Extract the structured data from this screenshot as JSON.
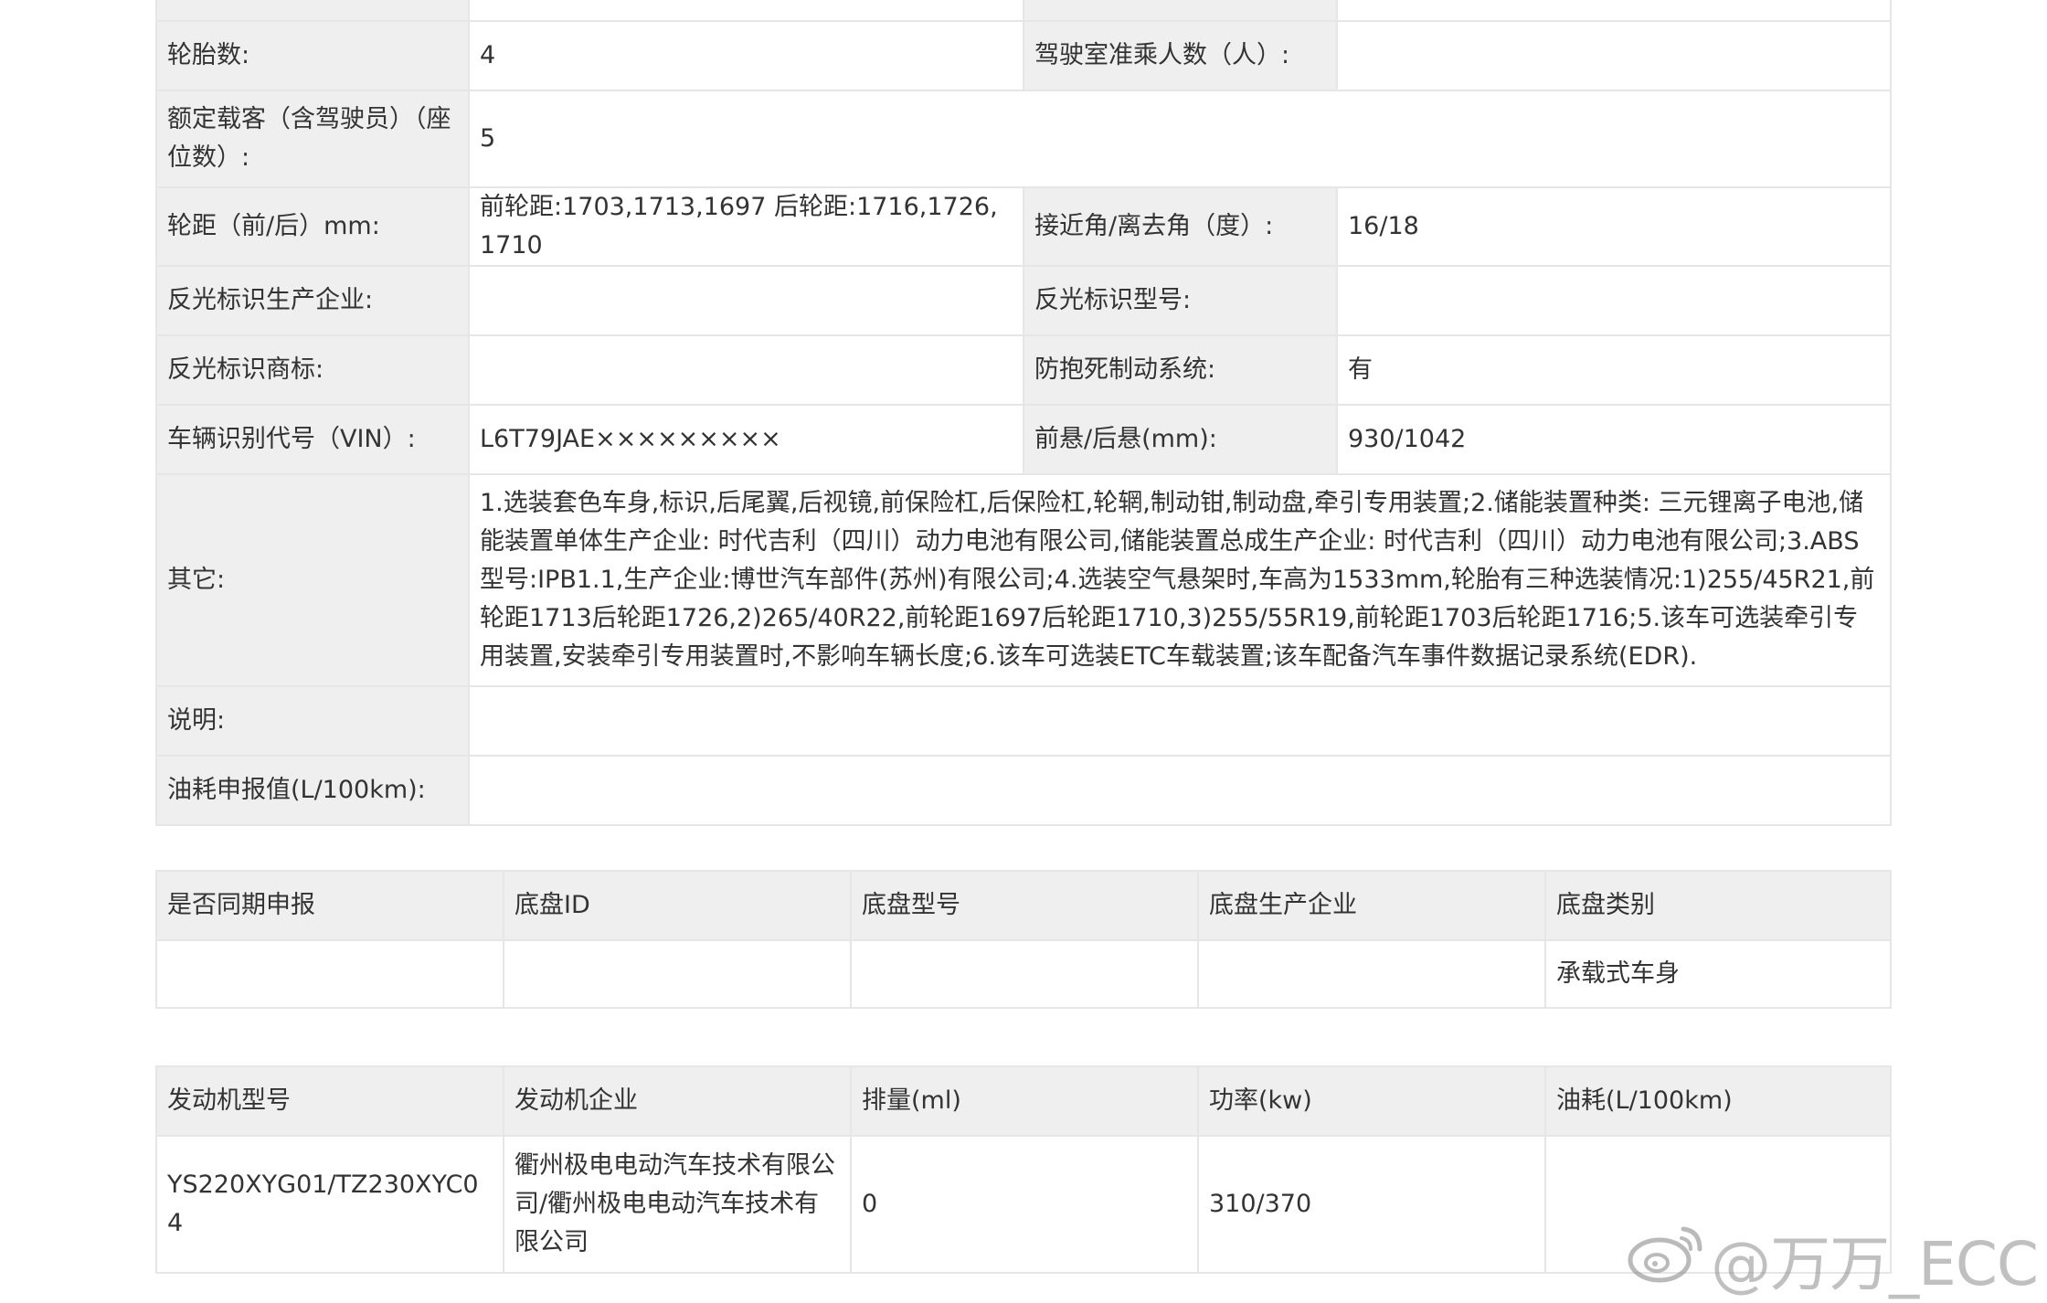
{
  "spec": {
    "top_partial": {
      "label": "",
      "value": "",
      "label2": "",
      "value2": ""
    },
    "tires": {
      "label": "轮胎数:",
      "value": "4",
      "label2": "驾驶室准乘人数（人）:",
      "value2": ""
    },
    "seats": {
      "label": "额定载客（含驾驶员）（座位数）:",
      "value": "5"
    },
    "track": {
      "label": "轮距（前/后）mm:",
      "value": "前轮距:1703,1713,1697 后轮距:1716,1726,1710",
      "label2": "接近角/离去角（度）:",
      "value2": "16/18"
    },
    "reflective_maker": {
      "label": "反光标识生产企业:",
      "value": "",
      "label2": "反光标识型号:",
      "value2": ""
    },
    "reflective_brand": {
      "label": "反光标识商标:",
      "value": "",
      "label2": "防抱死制动系统:",
      "value2": "有"
    },
    "vin": {
      "label": "车辆识别代号（VIN）:",
      "value": "L6T79JAE×××××××××",
      "label2": "前悬/后悬(mm):",
      "value2": "930/1042"
    },
    "other": {
      "label": "其它:",
      "value": "1.选装套色车身,标识,后尾翼,后视镜,前保险杠,后保险杠,轮辋,制动钳,制动盘,牵引专用装置;2.储能装置种类: 三元锂离子电池,储能装置单体生产企业: 时代吉利（四川）动力电池有限公司,储能装置总成生产企业: 时代吉利（四川）动力电池有限公司;3.ABS型号:IPB1.1,生产企业:博世汽车部件(苏州)有限公司;4.选装空气悬架时,车高为1533mm,轮胎有三种选装情况:1)255/45R21,前轮距1713后轮距1726,2)265/40R22,前轮距1697后轮距1710,3)255/55R19,前轮距1703后轮距1716;5.该车可选装牵引专用装置,安装牵引专用装置时,不影响车辆长度;6.该车可选装ETC车载装置;该车配备汽车事件数据记录系统(EDR)."
    },
    "notes": {
      "label": "说明:",
      "value": ""
    },
    "fuel": {
      "label": "油耗申报值(L/100km):",
      "value": ""
    }
  },
  "chassis": {
    "headers": [
      "是否同期申报",
      "底盘ID",
      "底盘型号",
      "底盘生产企业",
      "底盘类别"
    ],
    "row": [
      "",
      "",
      "",
      "",
      "承载式车身"
    ]
  },
  "engine": {
    "headers": [
      "发动机型号",
      "发动机企业",
      "排量(ml)",
      "功率(kw)",
      "油耗(L/100km)"
    ],
    "row": [
      "YS220XYG01/TZ230XYC04",
      "衢州极电电动汽车技术有限公司/衢州极电电动汽车技术有限公司",
      "0",
      "310/370",
      ""
    ]
  },
  "watermark": {
    "text": "@万万_ECC",
    "icon": "weibo-icon"
  }
}
